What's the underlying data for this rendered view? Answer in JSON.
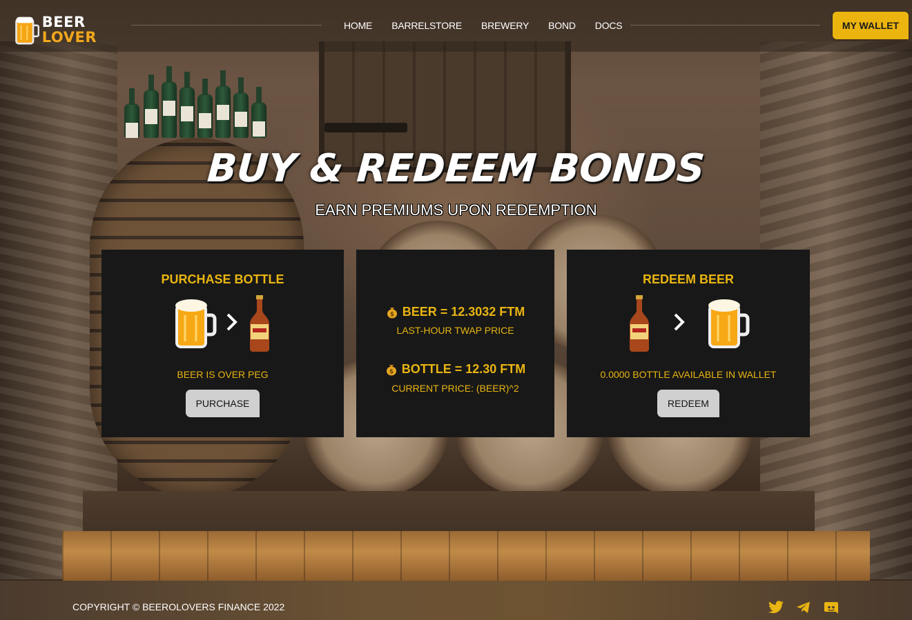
{
  "brand": {
    "line1": "BEER",
    "line2": "LOVER",
    "accent_color": "#f2a81c"
  },
  "nav": {
    "items": [
      {
        "label": "HOME"
      },
      {
        "label": "BARRELSTORE"
      },
      {
        "label": "BREWERY"
      },
      {
        "label": "BOND"
      },
      {
        "label": "DOCS"
      }
    ],
    "wallet_label": "MY WALLET",
    "wallet_color": "#ebb40e"
  },
  "hero": {
    "title": "BUY & REDEEM BONDS",
    "subtitle": "EARN PREMIUMS UPON REDEMPTION"
  },
  "purchase_card": {
    "title": "PURCHASE BOTTLE",
    "from_icon": "beer-mug-icon",
    "arrow_icon": "chevron-right-icon",
    "to_icon": "beer-bottle-icon",
    "status": "BEER IS OVER PEG",
    "button_label": "PURCHASE"
  },
  "price_card": {
    "beer_price": "BEER = 12.3032 FTM",
    "beer_caption": "LAST-HOUR TWAP PRICE",
    "bottle_price": "BOTTLE = 12.30 FTM",
    "bottle_caption": "CURRENT PRICE: (BEER)^2",
    "icon": "money-bag-icon"
  },
  "redeem_card": {
    "title": "REDEEM BEER",
    "from_icon": "beer-bottle-icon",
    "arrow_icon": "chevron-right-icon",
    "to_icon": "beer-mug-icon",
    "status": "0.0000 BOTTLE AVAILABLE IN WALLET",
    "button_label": "REDEEM"
  },
  "footer": {
    "copyright": "COPYRIGHT © BEEROLOVERS FINANCE 2022",
    "social_icons": [
      "twitter-icon",
      "telegram-icon",
      "discord-icon"
    ]
  },
  "colors": {
    "card_bg": "#181818",
    "card_text": "#e9b512",
    "button_bg": "#d0d0d0"
  }
}
